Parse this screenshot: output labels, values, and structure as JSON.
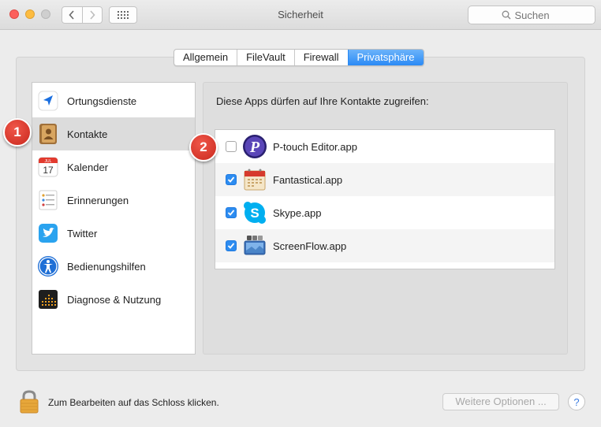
{
  "window": {
    "title": "Sicherheit",
    "search_placeholder": "Suchen"
  },
  "tabs": [
    {
      "label": "Allgemein",
      "active": false
    },
    {
      "label": "FileVault",
      "active": false
    },
    {
      "label": "Firewall",
      "active": false
    },
    {
      "label": "Privatsphäre",
      "active": true
    }
  ],
  "sidebar": {
    "items": [
      {
        "label": "Ortungsdienste",
        "icon": "location-arrow-icon"
      },
      {
        "label": "Kontakte",
        "icon": "contacts-book-icon",
        "selected": true
      },
      {
        "label": "Kalender",
        "icon": "calendar-icon",
        "month": "JUL",
        "day": "17"
      },
      {
        "label": "Erinnerungen",
        "icon": "reminders-icon"
      },
      {
        "label": "Twitter",
        "icon": "twitter-icon"
      },
      {
        "label": "Bedienungshilfen",
        "icon": "accessibility-icon"
      },
      {
        "label": "Diagnose & Nutzung",
        "icon": "diagnostics-icon"
      }
    ]
  },
  "pane": {
    "heading": "Diese Apps dürfen auf Ihre Kontakte zugreifen:",
    "apps": [
      {
        "label": "P-touch Editor.app",
        "checked": false,
        "icon": "ptouch-editor-icon",
        "icon_letter": "P"
      },
      {
        "label": "Fantastical.app",
        "checked": true,
        "icon": "fantastical-icon"
      },
      {
        "label": "Skype.app",
        "checked": true,
        "icon": "skype-icon",
        "icon_letter": "S"
      },
      {
        "label": "ScreenFlow.app",
        "checked": true,
        "icon": "screenflow-icon"
      }
    ]
  },
  "badges": {
    "one": "1",
    "two": "2"
  },
  "footer": {
    "lock_text": "Zum Bearbeiten auf das Schloss klicken.",
    "more_options": "Weitere Optionen ...",
    "help": "?"
  },
  "colors": {
    "accent": "#2a8af5",
    "badge": "#d9342a"
  }
}
